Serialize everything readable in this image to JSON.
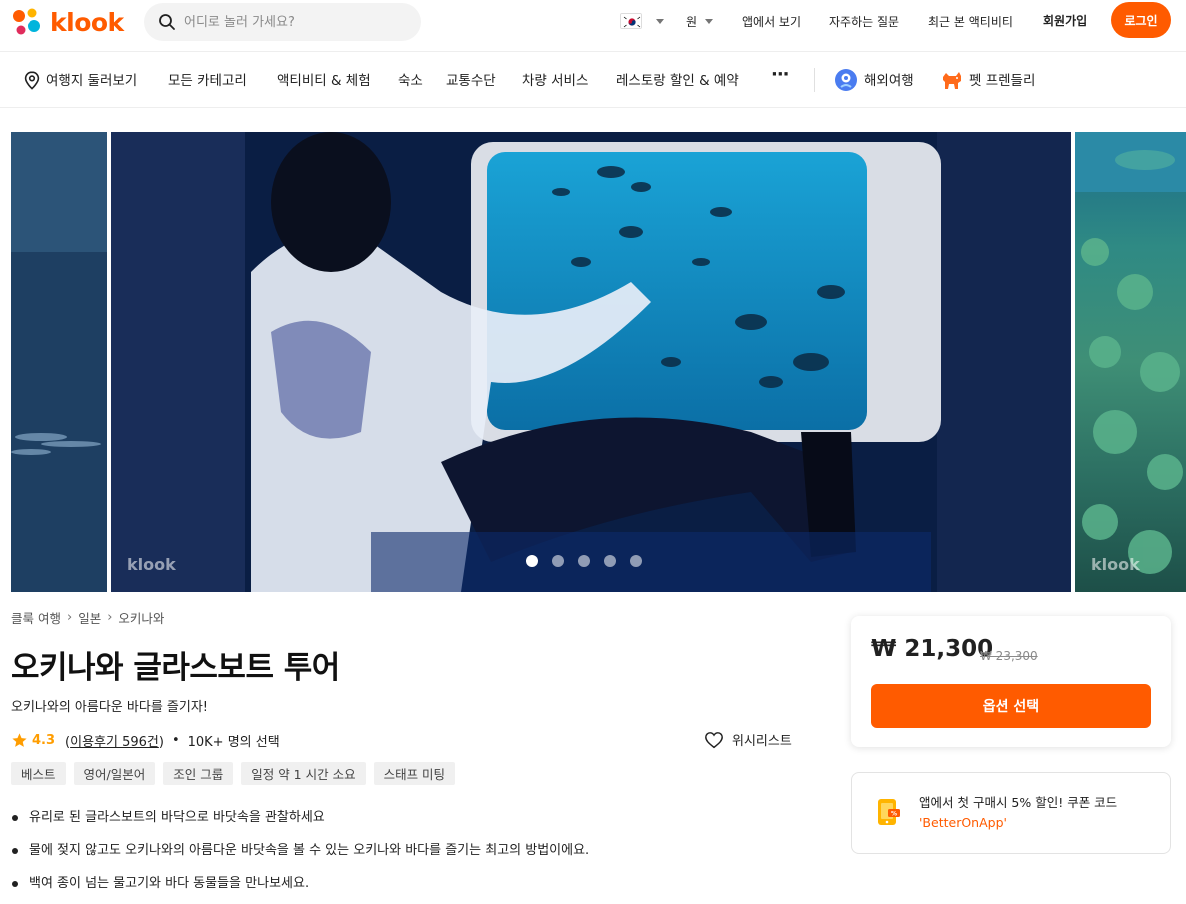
{
  "header": {
    "logo_text": "klook",
    "search_placeholder": "어디로 놀러 가세요?",
    "currency": "원",
    "links": [
      "앱에서 보기",
      "자주하는 질문",
      "최근 본 액티비티"
    ],
    "signup_label": "회원가입",
    "login_label": "로그인"
  },
  "categories": {
    "items": [
      "여행지 둘러보기",
      "모든 카테고리",
      "액티비티 & 체험",
      "숙소",
      "교통수단",
      "차량 서비스",
      "레스토랑 할인 & 예약"
    ],
    "more": "···",
    "extra": [
      "해외여행",
      "펫 프렌들리"
    ]
  },
  "gallery": {
    "watermark": "klook",
    "slide_count": 5,
    "active_slide": 1
  },
  "breadcrumb": [
    "클룩 여행",
    "일본",
    "오키나와"
  ],
  "activity": {
    "title": "오키나와 글라스보트 투어",
    "subtitle": "오키나와의 아름다운 바다를 즐기자!",
    "rating": "4.3",
    "reviews_open": "(",
    "reviews_label": "이용후기 596건",
    "reviews_close": ")",
    "booked": "10K+ 명의 선택",
    "wishlist_label": "위시리스트",
    "tags": [
      "베스트",
      "영어/일본어",
      "조인 그룹",
      "일정 약 1 시간 소요",
      "스태프 미팅"
    ],
    "highlights": [
      "유리로 된 글라스보트의 바닥으로 바닷속을 관찰하세요",
      "물에 젖지 않고도 오키나와의 아름다운 바닷속을 볼 수 있는 오키나와 바다를 즐기는 최고의 방법이에요.",
      "백여 종이 넘는 물고기와 바다 동물들을 만나보세요."
    ]
  },
  "booking": {
    "price": "₩ 21,300",
    "old_price": "₩ 23,300",
    "option_button": "옵션 선택"
  },
  "promo": {
    "text": "앱에서 첫 구매시 5% 할인! 쿠폰 코드",
    "code": "'BetterOnApp'"
  },
  "colors": {
    "brand": "#ff5b00",
    "star": "#ff9d00"
  }
}
